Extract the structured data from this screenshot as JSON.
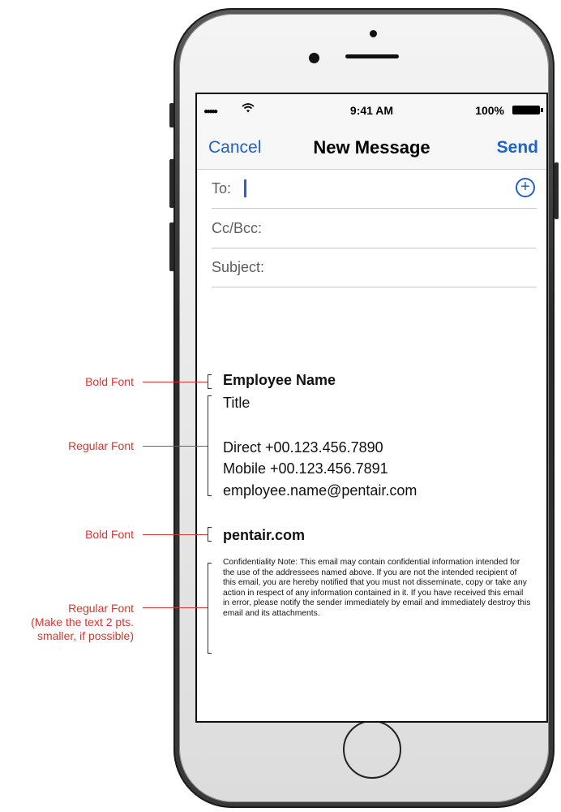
{
  "annotations": [
    {
      "label": "Bold Font"
    },
    {
      "label": "Regular Font"
    },
    {
      "label": "Bold Font"
    },
    {
      "label": "Regular Font\n(Make the text 2 pts.\nsmaller, if possible)"
    }
  ],
  "status_bar": {
    "signal": "●●●●●",
    "time": "9:41 AM",
    "battery_pct": "100%"
  },
  "compose": {
    "cancel_label": "Cancel",
    "title": "New Message",
    "send_label": "Send",
    "to_label": "To:",
    "cc_label": "Cc/Bcc:",
    "subject_label": "Subject:"
  },
  "signature": {
    "name": "Employee Name",
    "title": "Title",
    "direct": "Direct +00.123.456.7890",
    "mobile": "Mobile +00.123.456.7891",
    "email": "employee.name@pentair.com",
    "website": "pentair.com",
    "confidentiality": "Confidentiality Note: This email may contain confidential information intended for the use of the addressees named above. If you are not the intended recipient of this email, you are hereby notified that you must not disseminate, copy or take any action in respect of any information contained in it. If you have received this email in error, please notify the sender immediately by email and immediately destroy this email and its attachments."
  },
  "colors": {
    "accent_blue": "#1f62c9",
    "annotation_red": "#d0392f",
    "cursor_blue": "#2d5bd7"
  },
  "icons": [
    "wifi-icon",
    "battery-icon",
    "add-contact-icon",
    "home-button"
  ]
}
